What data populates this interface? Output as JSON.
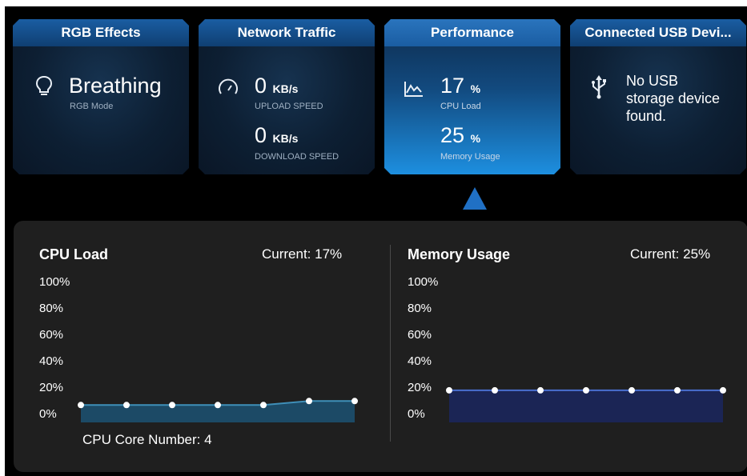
{
  "cards": {
    "rgb": {
      "title": "RGB Effects",
      "value": "Breathing",
      "caption": "RGB Mode",
      "icon": "lightbulb-icon"
    },
    "network": {
      "title": "Network Traffic",
      "upload_value": "0",
      "upload_unit": "KB/s",
      "upload_caption": "UPLOAD SPEED",
      "download_value": "0",
      "download_unit": "KB/s",
      "download_caption": "DOWNLOAD SPEED",
      "icon": "speedometer-icon"
    },
    "performance": {
      "title": "Performance",
      "cpu_value": "17",
      "cpu_unit": "%",
      "cpu_caption": "CPU Load",
      "mem_value": "25",
      "mem_unit": "%",
      "mem_caption": "Memory Usage",
      "icon": "line-chart-icon"
    },
    "usb": {
      "title": "Connected USB Devi...",
      "message_line1": "No USB",
      "message_line2": "storage device",
      "message_line3": "found.",
      "icon": "usb-icon"
    }
  },
  "panel": {
    "cpu": {
      "title": "CPU Load",
      "current": "Current: 17%",
      "core_number": "CPU Core Number: 4"
    },
    "memory": {
      "title": "Memory Usage",
      "current": "Current: 25%"
    },
    "y_ticks": [
      "100%",
      "80%",
      "60%",
      "40%",
      "20%",
      "0%"
    ]
  },
  "colors": {
    "accent": "#2070c4",
    "cpu_fill": "#1c4a66",
    "cpu_line": "#3f8fb8",
    "mem_fill": "#1b2555",
    "mem_line": "#4a6fd0"
  },
  "chart_data": [
    {
      "type": "area",
      "title": "CPU Load",
      "x": [
        1,
        2,
        3,
        4,
        5,
        6,
        7
      ],
      "series": [
        {
          "values": [
            13,
            13,
            13,
            13,
            13,
            16,
            16
          ]
        }
      ],
      "ylim": [
        0,
        100
      ],
      "ytick_labels": [
        "0%",
        "20%",
        "40%",
        "60%",
        "80%",
        "100%"
      ]
    },
    {
      "type": "area",
      "title": "Memory Usage",
      "x": [
        1,
        2,
        3,
        4,
        5,
        6,
        7
      ],
      "series": [
        {
          "values": [
            24,
            24,
            24,
            24,
            24,
            24,
            24
          ]
        }
      ],
      "ylim": [
        0,
        100
      ],
      "ytick_labels": [
        "0%",
        "20%",
        "40%",
        "60%",
        "80%",
        "100%"
      ]
    }
  ]
}
